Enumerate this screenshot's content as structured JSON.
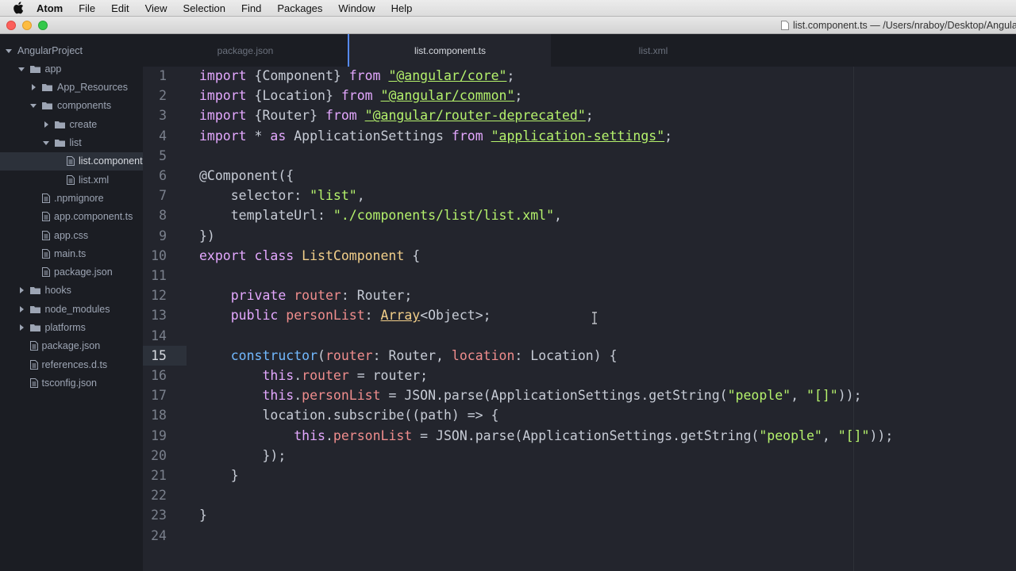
{
  "menubar": {
    "items": [
      "Atom",
      "File",
      "Edit",
      "View",
      "Selection",
      "Find",
      "Packages",
      "Window",
      "Help"
    ]
  },
  "window": {
    "title": "list.component.ts — /Users/nraboy/Desktop/AngularProject"
  },
  "tree": {
    "items": [
      {
        "label": "AngularProject",
        "type": "project",
        "depth": 0,
        "expanded": true
      },
      {
        "label": "app",
        "type": "folder",
        "depth": 1,
        "expanded": true
      },
      {
        "label": "App_Resources",
        "type": "folder",
        "depth": 2,
        "expanded": false
      },
      {
        "label": "components",
        "type": "folder",
        "depth": 2,
        "expanded": true
      },
      {
        "label": "create",
        "type": "folder",
        "depth": 3,
        "expanded": false
      },
      {
        "label": "list",
        "type": "folder",
        "depth": 3,
        "expanded": true
      },
      {
        "label": "list.component.ts",
        "type": "file",
        "depth": 4,
        "selected": true
      },
      {
        "label": "list.xml",
        "type": "file",
        "depth": 4
      },
      {
        "label": ".npmignore",
        "type": "file",
        "depth": 2
      },
      {
        "label": "app.component.ts",
        "type": "file",
        "depth": 2
      },
      {
        "label": "app.css",
        "type": "file",
        "depth": 2
      },
      {
        "label": "main.ts",
        "type": "file",
        "depth": 2
      },
      {
        "label": "package.json",
        "type": "file",
        "depth": 2
      },
      {
        "label": "hooks",
        "type": "folder",
        "depth": 1,
        "expanded": false
      },
      {
        "label": "node_modules",
        "type": "folder",
        "depth": 1,
        "expanded": false
      },
      {
        "label": "platforms",
        "type": "folder",
        "depth": 1,
        "expanded": false
      },
      {
        "label": "package.json",
        "type": "file",
        "depth": 1
      },
      {
        "label": "references.d.ts",
        "type": "file",
        "depth": 1
      },
      {
        "label": "tsconfig.json",
        "type": "file",
        "depth": 1
      }
    ]
  },
  "tabs": [
    {
      "label": "package.json",
      "active": false
    },
    {
      "label": "list.component.ts",
      "active": true
    },
    {
      "label": "list.xml",
      "active": false
    }
  ],
  "editor": {
    "current_line": 15,
    "lines": [
      [
        [
          "kw",
          "import"
        ],
        [
          "pl",
          " {Component} "
        ],
        [
          "kw",
          "from"
        ],
        [
          "pl",
          " "
        ],
        [
          "strl",
          "\"@angular/core\""
        ],
        [
          "pl",
          ";"
        ]
      ],
      [
        [
          "kw",
          "import"
        ],
        [
          "pl",
          " {Location} "
        ],
        [
          "kw",
          "from"
        ],
        [
          "pl",
          " "
        ],
        [
          "strl",
          "\"@angular/common\""
        ],
        [
          "pl",
          ";"
        ]
      ],
      [
        [
          "kw",
          "import"
        ],
        [
          "pl",
          " {Router} "
        ],
        [
          "kw",
          "from"
        ],
        [
          "pl",
          " "
        ],
        [
          "strl",
          "\"@angular/router-deprecated\""
        ],
        [
          "pl",
          ";"
        ]
      ],
      [
        [
          "kw",
          "import"
        ],
        [
          "pl",
          " * "
        ],
        [
          "kw",
          "as"
        ],
        [
          "pl",
          " ApplicationSettings "
        ],
        [
          "kw",
          "from"
        ],
        [
          "pl",
          " "
        ],
        [
          "strl",
          "\"application-settings\""
        ],
        [
          "pl",
          ";"
        ]
      ],
      [],
      [
        [
          "pl",
          "@Component({"
        ]
      ],
      [
        [
          "pl",
          "    selector: "
        ],
        [
          "str",
          "\"list\""
        ],
        [
          "pl",
          ","
        ]
      ],
      [
        [
          "pl",
          "    templateUrl: "
        ],
        [
          "str",
          "\"./components/list/list.xml\""
        ],
        [
          "pl",
          ","
        ]
      ],
      [
        [
          "pl",
          "})"
        ]
      ],
      [
        [
          "kw",
          "export"
        ],
        [
          "pl",
          " "
        ],
        [
          "kw",
          "class"
        ],
        [
          "pl",
          " "
        ],
        [
          "cls",
          "ListComponent"
        ],
        [
          "pl",
          " {"
        ]
      ],
      [],
      [
        [
          "pl",
          "    "
        ],
        [
          "kw",
          "private"
        ],
        [
          "pl",
          " "
        ],
        [
          "prop",
          "router"
        ],
        [
          "pl",
          ": Router;"
        ]
      ],
      [
        [
          "pl",
          "    "
        ],
        [
          "kw",
          "public"
        ],
        [
          "pl",
          " "
        ],
        [
          "prop",
          "personList"
        ],
        [
          "pl",
          ": "
        ],
        [
          "clsu",
          "Array"
        ],
        [
          "pl",
          "<Object>;"
        ]
      ],
      [],
      [
        [
          "pl",
          "    "
        ],
        [
          "fn",
          "constructor"
        ],
        [
          "pl",
          "("
        ],
        [
          "prop",
          "router"
        ],
        [
          "pl",
          ": Router, "
        ],
        [
          "prop",
          "location"
        ],
        [
          "pl",
          ": Location) {"
        ]
      ],
      [
        [
          "pl",
          "        "
        ],
        [
          "kw",
          "this"
        ],
        [
          "pl",
          "."
        ],
        [
          "prop",
          "router"
        ],
        [
          "pl",
          " = router;"
        ]
      ],
      [
        [
          "pl",
          "        "
        ],
        [
          "kw",
          "this"
        ],
        [
          "pl",
          "."
        ],
        [
          "prop",
          "personList"
        ],
        [
          "pl",
          " = JSON.parse(ApplicationSettings.getString("
        ],
        [
          "str",
          "\"people\""
        ],
        [
          "pl",
          ", "
        ],
        [
          "str",
          "\"[]\""
        ],
        [
          "pl",
          "));"
        ]
      ],
      [
        [
          "pl",
          "        location.subscribe((path) => {"
        ]
      ],
      [
        [
          "pl",
          "            "
        ],
        [
          "kw",
          "this"
        ],
        [
          "pl",
          "."
        ],
        [
          "prop",
          "personList"
        ],
        [
          "pl",
          " = JSON.parse(ApplicationSettings.getString("
        ],
        [
          "str",
          "\"people\""
        ],
        [
          "pl",
          ", "
        ],
        [
          "str",
          "\"[]\""
        ],
        [
          "pl",
          "));"
        ]
      ],
      [
        [
          "pl",
          "        });"
        ]
      ],
      [
        [
          "pl",
          "    }"
        ]
      ],
      [],
      [
        [
          "pl",
          "}"
        ]
      ],
      []
    ]
  },
  "colors": {
    "keyword": "#e4a8ff",
    "string": "#b5f26c",
    "function": "#72b9ff",
    "class": "#f2cf8a",
    "property": "#f08d8d",
    "plain": "#c7ccd6",
    "editor_bg": "#23252d",
    "tree_bg": "#1b1d23",
    "tab_accent": "#568af2"
  }
}
